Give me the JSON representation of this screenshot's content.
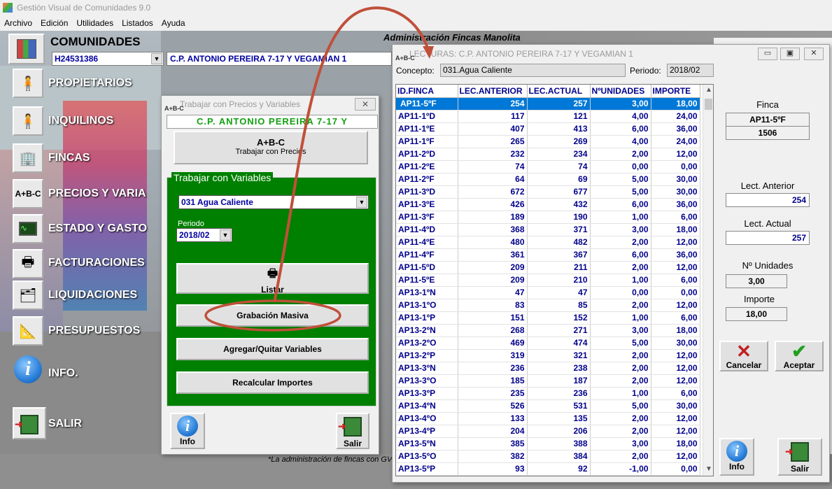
{
  "app": {
    "title": "Gestión  Visual de Comunidades  9.0",
    "menu": [
      "Archivo",
      "Edición",
      "Utilidades",
      "Listados",
      "Ayuda"
    ]
  },
  "header": {
    "section_label": "COMUNIDADES",
    "admin_title": "Administración Fincas Manolita",
    "community_code": "H24531386",
    "community_name": "C.P. ANTONIO PEREIRA 7-17 Y VEGAMIAN 1"
  },
  "sidebar": [
    {
      "label": "PROPIETARIOS",
      "icon": "person-icon"
    },
    {
      "label": "INQUILINOS",
      "icon": "tenant-icon"
    },
    {
      "label": "FINCAS",
      "icon": "building-icon"
    },
    {
      "label": "PRECIOS Y VARIA",
      "icon": "abc-icon"
    },
    {
      "label": "ESTADO  Y  GASTO",
      "icon": "chart-icon"
    },
    {
      "label": "FACTURACIONES",
      "icon": "printer-icon"
    },
    {
      "label": "LIQUIDACIONES",
      "icon": "documents-icon"
    },
    {
      "label": "PRESUPUESTOS",
      "icon": "ruler-icon"
    },
    {
      "label": "INFO.",
      "icon": "info-icon"
    },
    {
      "label": "SALIR",
      "icon": "exit-icon"
    }
  ],
  "footer_note": "*La administración de fincas con GV",
  "precios_dialog": {
    "title": "Trabajar con Precios y Variables",
    "close": "✕",
    "community": "C.P. ANTONIO PEREIRA 7-17 Y",
    "work_prices_icon": "A+B-C",
    "work_prices_label": "Trabajar con Precios",
    "variables_legend": "Trabajar con Variables",
    "concept": "031 Agua Caliente",
    "period_label": "Periodo",
    "period": "2018/02",
    "list_label": "Listar",
    "mass_record_label": "Grabación Masiva",
    "add_remove_label": "Agregar/Quitar Variables",
    "recalc_label": "Recalcular Importes",
    "info_label": "Info",
    "exit_label": "Salir"
  },
  "lecturas": {
    "title": "LECTURAS:  C.P. ANTONIO PEREIRA 7-17 Y VEGAMIAN 1",
    "concept_label": "Concepto:",
    "concept": "031.Agua Caliente",
    "period_label": "Periodo:",
    "period": "2018/02",
    "columns": [
      "ID.FINCA",
      "LEC.ANTERIOR",
      "LEC.ACTUAL",
      "NºUNIDADES",
      "IMPORTE"
    ],
    "rows": [
      [
        "AP11-5ºF",
        "254",
        "257",
        "3,00",
        "18,00"
      ],
      [
        "AP11-1ºD",
        "117",
        "121",
        "4,00",
        "24,00"
      ],
      [
        "AP11-1ºE",
        "407",
        "413",
        "6,00",
        "36,00"
      ],
      [
        "AP11-1ºF",
        "265",
        "269",
        "4,00",
        "24,00"
      ],
      [
        "AP11-2ºD",
        "232",
        "234",
        "2,00",
        "12,00"
      ],
      [
        "AP11-2ºE",
        "74",
        "74",
        "0,00",
        "0,00"
      ],
      [
        "AP11-2ºF",
        "64",
        "69",
        "5,00",
        "30,00"
      ],
      [
        "AP11-3ºD",
        "672",
        "677",
        "5,00",
        "30,00"
      ],
      [
        "AP11-3ºE",
        "426",
        "432",
        "6,00",
        "36,00"
      ],
      [
        "AP11-3ºF",
        "189",
        "190",
        "1,00",
        "6,00"
      ],
      [
        "AP11-4ºD",
        "368",
        "371",
        "3,00",
        "18,00"
      ],
      [
        "AP11-4ºE",
        "480",
        "482",
        "2,00",
        "12,00"
      ],
      [
        "AP11-4ºF",
        "361",
        "367",
        "6,00",
        "36,00"
      ],
      [
        "AP11-5ºD",
        "209",
        "211",
        "2,00",
        "12,00"
      ],
      [
        "AP11-5ºE",
        "209",
        "210",
        "1,00",
        "6,00"
      ],
      [
        "AP13-1ºN",
        "47",
        "47",
        "0,00",
        "0,00"
      ],
      [
        "AP13-1ºO",
        "83",
        "85",
        "2,00",
        "12,00"
      ],
      [
        "AP13-1ºP",
        "151",
        "152",
        "1,00",
        "6,00"
      ],
      [
        "AP13-2ºN",
        "268",
        "271",
        "3,00",
        "18,00"
      ],
      [
        "AP13-2ºO",
        "469",
        "474",
        "5,00",
        "30,00"
      ],
      [
        "AP13-2ºP",
        "319",
        "321",
        "2,00",
        "12,00"
      ],
      [
        "AP13-3ºN",
        "236",
        "238",
        "2,00",
        "12,00"
      ],
      [
        "AP13-3ºO",
        "185",
        "187",
        "2,00",
        "12,00"
      ],
      [
        "AP13-3ºP",
        "235",
        "236",
        "1,00",
        "6,00"
      ],
      [
        "AP13-4ºN",
        "526",
        "531",
        "5,00",
        "30,00"
      ],
      [
        "AP13-4ºO",
        "133",
        "135",
        "2,00",
        "12,00"
      ],
      [
        "AP13-4ºP",
        "204",
        "206",
        "2,00",
        "12,00"
      ],
      [
        "AP13-5ºN",
        "385",
        "388",
        "3,00",
        "18,00"
      ],
      [
        "AP13-5ºO",
        "382",
        "384",
        "2,00",
        "12,00"
      ],
      [
        "AP13-5ºP",
        "93",
        "92",
        "-1,00",
        "0,00"
      ]
    ],
    "selected_row": 0,
    "detail": {
      "finca_label": "Finca",
      "finca": "AP11-5ºF",
      "finca_code": "1506",
      "prev_label": "Lect. Anterior",
      "prev": "254",
      "curr_label": "Lect. Actual",
      "curr": "257",
      "units_label": "Nº Unidades",
      "units": "3,00",
      "amount_label": "Importe",
      "amount": "18,00"
    },
    "cancel_label": "Cancelar",
    "accept_label": "Aceptar",
    "info_label": "Info",
    "exit_label": "Salir"
  },
  "colors": {
    "selection": "#0078d7",
    "green_panel": "#008000",
    "annotation": "#c0503a",
    "grid_text": "#00008b"
  }
}
